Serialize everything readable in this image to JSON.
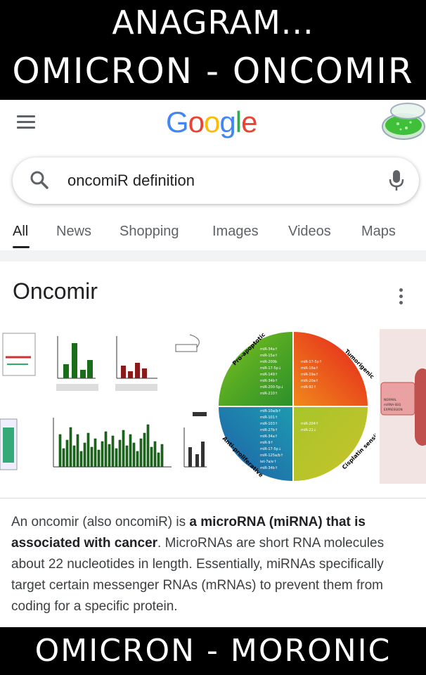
{
  "top_banner": {
    "line1": "ANAGRAM...",
    "line2": "OMICRON  -  ONCOMIR"
  },
  "bottom_banner": {
    "text": "OMICRON  -  MORONIC"
  },
  "app": {
    "logo": {
      "G": "G",
      "o1": "o",
      "o2": "o",
      "g": "g",
      "l": "l",
      "e": "e"
    },
    "icons": [
      "menu-icon",
      "search-icon",
      "mic-icon",
      "petri-dish-icon",
      "more-vert-icon"
    ]
  },
  "search": {
    "query": "oncomiR definition"
  },
  "tabs": [
    "All",
    "News",
    "Shopping",
    "Images",
    "Videos",
    "Maps"
  ],
  "panel": {
    "title": "Oncomir",
    "wheel": {
      "quadrants": [
        "Pro-apoptotic",
        "Tumorigenic",
        "Anti-proliferative",
        "Cisplatin sensitivity"
      ],
      "q1_items": [
        "miR-34a↑",
        "miR-15a↑",
        "miR-200b",
        "miR-17-5p↓",
        "miR-149↑",
        "miR-34b↑",
        "miR-200-5p↓",
        "miR-210↑"
      ],
      "q2_items": [
        "miR-17-5p↑",
        "miR-18a↑",
        "miR-19a↑",
        "miR-20a↑",
        "miR-92↑"
      ],
      "q3_items": [
        "miR-10a/b↑",
        "miR-101↑",
        "miR-103↑",
        "miR-27b↑",
        "miR-34a↑",
        "miR-9↑",
        "miR-17-5p↓",
        "miR-125a/b↑",
        "let-7a/e↑",
        "miR-34b↑"
      ],
      "q4_items": [
        "miR-204↑",
        "miR-21↓"
      ]
    },
    "side_chip": [
      "NORMAL",
      "miRNA-SEQ",
      "EXPRESSION"
    ],
    "description": {
      "p1": "An oncomir (also oncomiR) is ",
      "b1": "a microRNA (miRNA) that is associated with cancer",
      "p2": ". MicroRNAs are short RNA molecules about 22 nucleotides in length. Essentially, miRNAs specifically target certain messenger RNAs (mRNAs) to prevent them from coding for a specific protein."
    }
  },
  "colors": {
    "google_blue": "#4285f4",
    "google_red": "#ea4335",
    "google_yellow": "#fbbc05",
    "google_green": "#34a853",
    "text_primary": "#202124",
    "text_secondary": "#5f6368"
  }
}
